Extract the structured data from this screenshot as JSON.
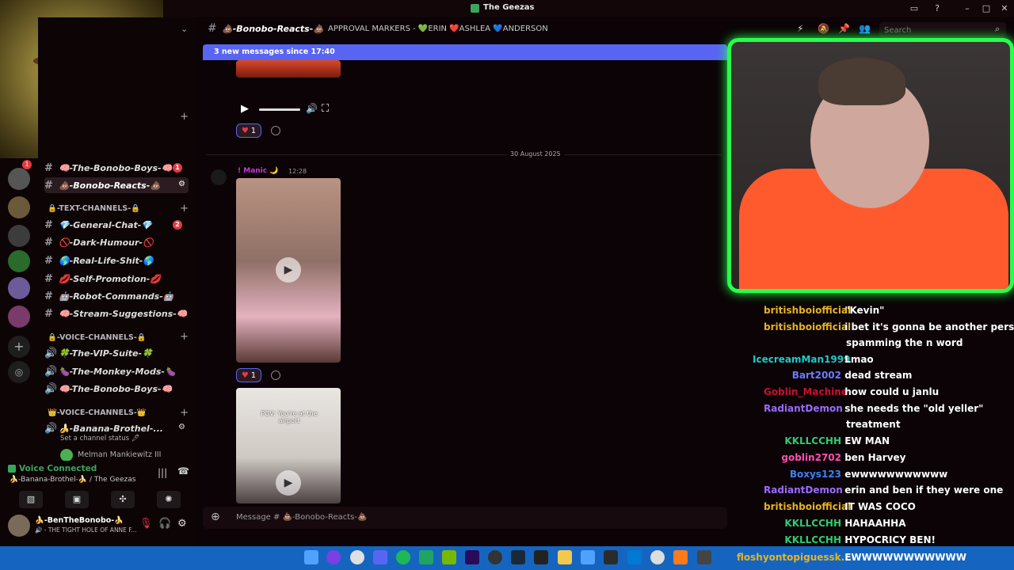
{
  "window": {
    "title": "The Geezas"
  },
  "header": {
    "channel_name": "💩-Bonobo-Reacts-💩",
    "topic": "APPROVAL MARKERS - 💚ERIN ❤️ASHLEA 💙ANDERSON",
    "search_placeholder": "Search"
  },
  "banner": {
    "new_messages": "3 new messages since 17:40"
  },
  "sidebar": {
    "channels_top": [
      {
        "name": "🧠-The-Bonobo-Boys-🧠",
        "badge": "1"
      },
      {
        "name": "💩-Bonobo-Reacts-💩",
        "badge": ""
      }
    ],
    "text_category": "🔒-TEXT-CHANNELS-🔒",
    "text_channels": [
      {
        "name": "💎-General-Chat-💎",
        "badge": "2"
      },
      {
        "name": "🚫-Dark-Humour-🚫",
        "badge": ""
      },
      {
        "name": "🌎-Real-Life-Shit-🌎",
        "badge": ""
      },
      {
        "name": "💋-Self-Promotion-💋",
        "badge": ""
      },
      {
        "name": "🤖-Robot-Commands-🤖",
        "badge": ""
      },
      {
        "name": "🧠-Stream-Suggestions-🧠",
        "badge": ""
      }
    ],
    "voice_category": "🔒-VOICE-CHANNELS-🔒",
    "voice_channels": [
      {
        "name": "🍀-The-VIP-Suite-🍀"
      },
      {
        "name": "🍆-The-Monkey-Mods-🍆"
      },
      {
        "name": "🧠-The-Bonobo-Boys-🧠"
      }
    ],
    "voice_category2": "👑-VOICE-CHANNELS-👑",
    "active_voice": {
      "name": "🍌-Banana-Brothel-...",
      "status": "Set a channel status 🖊",
      "member": "Melman Mankiewitz III"
    }
  },
  "voice_panel": {
    "status": "Voice Connected",
    "location": "🍌-Banana-Brothel-🍌 / The Geezas"
  },
  "user": {
    "name": "🍌-BenTheBonobo-🍌",
    "status": "🔊 - THE TIGHT HOLE OF ANNE F..."
  },
  "messages": {
    "date_divider": "30 August 2025",
    "author": "! Manic 🌙",
    "time": "12:28",
    "reaction_count": "1",
    "video_caption": "POV: You're at the airport",
    "composer_placeholder": "Message # 💩-Bonobo-Reacts-💩"
  },
  "twitch_chat": [
    {
      "user": "britishboiofficial",
      "text": "\"Kevin\"",
      "color": "#e6b422"
    },
    {
      "user": "britishboiofficial",
      "text": "i bet it's gonna be another person",
      "color": "#e6b422"
    },
    {
      "user": "",
      "text": "spamming the n word",
      "color": "#e6b422"
    },
    {
      "user": "IcecreamMan1999",
      "text": "Lmao",
      "color": "#21c9c9"
    },
    {
      "user": "Bart2002",
      "text": "dead stream",
      "color": "#6b7bff"
    },
    {
      "user": "Goblin_Machine",
      "text": "how could u janlu",
      "color": "#c8102e"
    },
    {
      "user": "RadiantDemon",
      "text": "she needs the \"old yeller\"",
      "color": "#9b6bff"
    },
    {
      "user": "",
      "text": "treatment",
      "color": "#9b6bff"
    },
    {
      "user": "KKLLCCHH",
      "text": "EW MAN",
      "color": "#2ecc71"
    },
    {
      "user": "goblin2702",
      "text": "ben Harvey",
      "color": "#ff4fb3"
    },
    {
      "user": "Boxys123",
      "text": "ewwwwwwwwwww",
      "color": "#3b82f6"
    },
    {
      "user": "RadiantDemon",
      "text": "erin and ben if they were one",
      "color": "#9b6bff"
    },
    {
      "user": "britishboiofficial",
      "text": "IT WAS COCO",
      "color": "#e6b422"
    },
    {
      "user": "KKLLCCHH",
      "text": "HAHAAHHA",
      "color": "#2ecc71"
    },
    {
      "user": "KKLLCCHH",
      "text": "HYPOCRICY BEN!",
      "color": "#2ecc71"
    },
    {
      "user": "floshyontopiguessk...",
      "text": "EWWWWWWWWWWW",
      "color": "#e6b422"
    }
  ],
  "colors": {
    "accent": "#5865f2",
    "cam_border": "#27ff4d",
    "taskbar": "#1565c0"
  }
}
